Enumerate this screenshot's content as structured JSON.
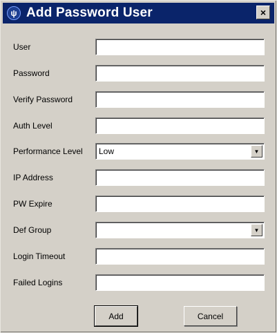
{
  "window": {
    "title": "Add Password User",
    "close_label": "×"
  },
  "form": {
    "fields": [
      {
        "label": "User",
        "value": ""
      },
      {
        "label": "Password",
        "value": ""
      },
      {
        "label": "Verify Password",
        "value": ""
      },
      {
        "label": "Auth Level",
        "value": ""
      },
      {
        "label": "Performance Level",
        "value": "Low",
        "type": "select"
      },
      {
        "label": "IP Address",
        "value": ""
      },
      {
        "label": "PW Expire",
        "value": ""
      },
      {
        "label": "Def Group",
        "value": "",
        "type": "select"
      },
      {
        "label": "Login Timeout",
        "value": ""
      },
      {
        "label": "Failed Logins",
        "value": ""
      }
    ]
  },
  "buttons": {
    "add_label": "Add",
    "cancel_label": "Cancel"
  },
  "icons": {
    "app": "app-logo-icon",
    "close": "close-icon",
    "dropdown": "chevron-down-icon"
  },
  "colors": {
    "titlebar": "#0a246a",
    "dialog_bg": "#d4d0c8"
  }
}
